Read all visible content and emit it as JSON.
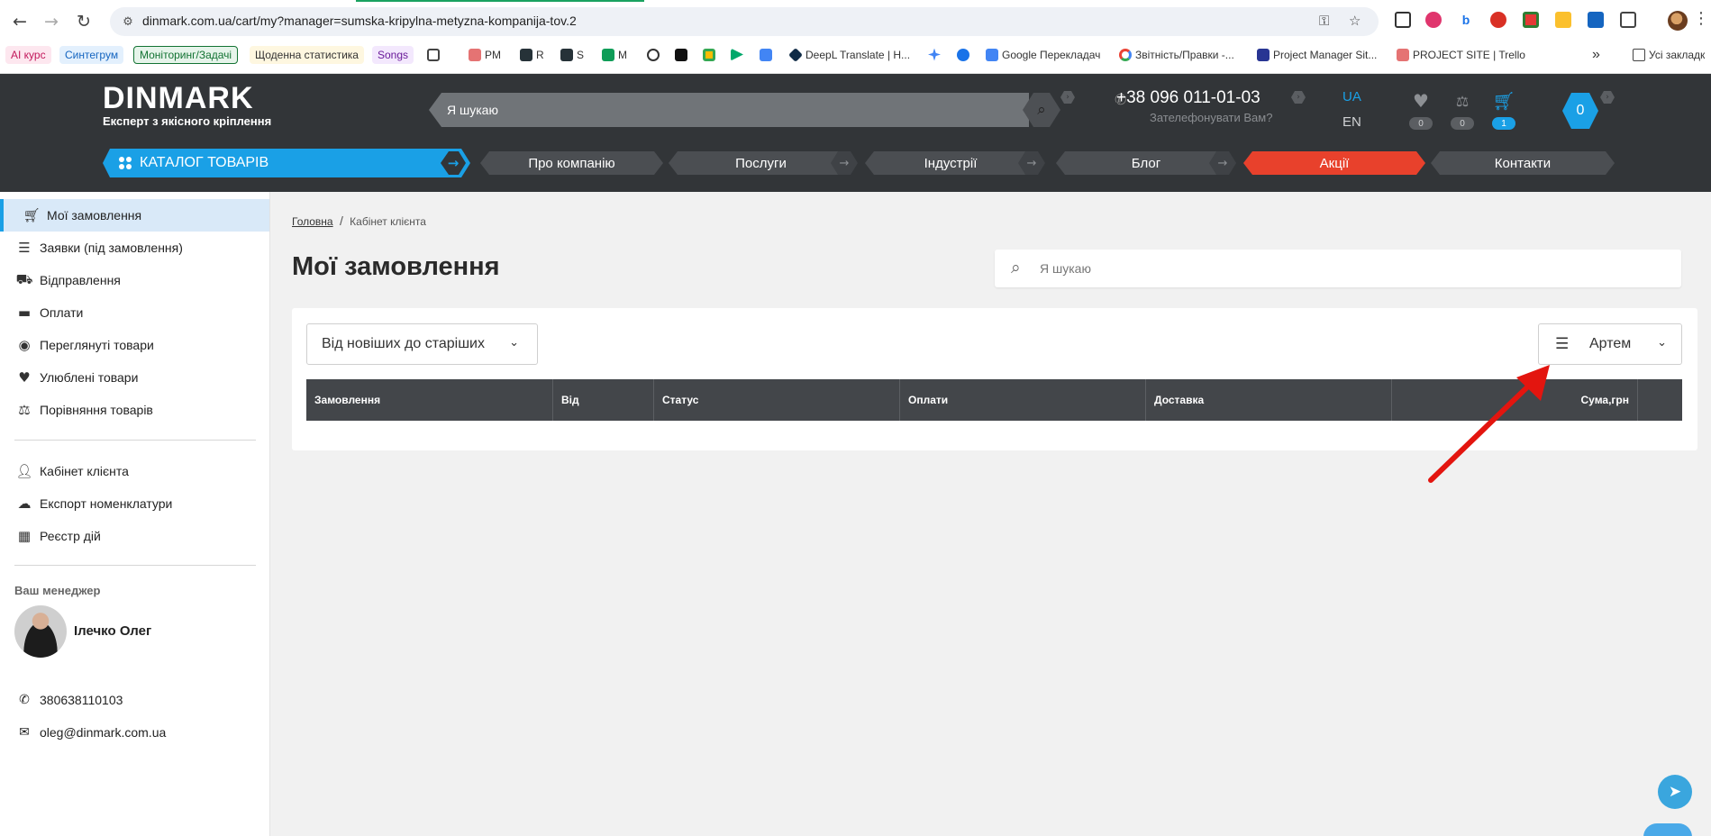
{
  "browser": {
    "url": "dinmark.com.ua/cart/my?manager=sumska-kripylna-metyzna-kompanija-tov.2",
    "bookmarks": [
      {
        "label": "AI курс",
        "kind": "chip-pink"
      },
      {
        "label": "Синтегрум",
        "kind": "chip-blue"
      },
      {
        "label": "Моніторинг/Задачі",
        "kind": "chip-green"
      },
      {
        "label": "Щоденна статистика",
        "kind": "chip-yellow"
      },
      {
        "label": "Songs",
        "kind": "chip-purple"
      },
      {
        "label": "",
        "kind": "grid"
      },
      {
        "label": "PM",
        "kind": "fav"
      },
      {
        "label": "R",
        "kind": "fav"
      },
      {
        "label": "S",
        "kind": "fav"
      },
      {
        "label": "M",
        "kind": "fav"
      },
      {
        "label": "",
        "kind": "fav"
      },
      {
        "label": "",
        "kind": "fav"
      },
      {
        "label": "",
        "kind": "fav"
      },
      {
        "label": "",
        "kind": "fav"
      },
      {
        "label": "",
        "kind": "fav"
      },
      {
        "label": "DeepL Translate | H...",
        "kind": "fav"
      },
      {
        "label": "",
        "kind": "fav"
      },
      {
        "label": "",
        "kind": "fav"
      },
      {
        "label": "Google Перекладач",
        "kind": "fav"
      },
      {
        "label": "Звітність/Правки -...",
        "kind": "fav"
      },
      {
        "label": "Project Manager Sit...",
        "kind": "fav"
      },
      {
        "label": "PROJECT SITE | Trello",
        "kind": "fav"
      }
    ],
    "more_bookmarks": "»",
    "all_bookmarks": "Усі закладк"
  },
  "site": {
    "logo_word": "DINMARK",
    "logo_tagline": "Експерт з якісного кріплення",
    "search_placeholder": "Я шукаю",
    "phone": "+38 096 011-01-03",
    "callback": "Зателефонувати Вам?",
    "lang_active": "UA",
    "lang_other": "EN",
    "favorites_count": "0",
    "compare_count": "0",
    "cart_count": "1",
    "account_badge": "0",
    "catalog_label": "КАТАЛОГ ТОВАРІВ",
    "menu": [
      "Про компанію",
      "Послуги",
      "Індустрії",
      "Блог",
      "Акції",
      "Контакти"
    ],
    "accent": "#1aa0e6",
    "promo_color": "#e8412c"
  },
  "sidebar": {
    "items": [
      {
        "label": "Мої замовлення",
        "icon": "cart-icon",
        "active": true
      },
      {
        "label": "Заявки (під замовлення)",
        "icon": "list-icon",
        "active": false
      },
      {
        "label": "Відправлення",
        "icon": "truck-icon",
        "active": false
      },
      {
        "label": "Оплати",
        "icon": "card-icon",
        "active": false
      },
      {
        "label": "Переглянуті товари",
        "icon": "eye-icon",
        "active": false
      },
      {
        "label": "Улюблені товари",
        "icon": "heart-icon",
        "active": false
      },
      {
        "label": "Порівняння товарів",
        "icon": "scales-icon",
        "active": false
      }
    ],
    "items2": [
      {
        "label": "Кабінет клієнта",
        "icon": "user-icon"
      },
      {
        "label": "Експорт номенклатури",
        "icon": "cloud-download-icon"
      },
      {
        "label": "Реєстр дій",
        "icon": "sitemap-icon"
      }
    ],
    "manager_label": "Ваш менеджер",
    "manager_name": "Ілечко Олег",
    "manager_phone": "380638110103",
    "manager_email": "oleg@dinmark.com.ua"
  },
  "main": {
    "breadcrumb_home": "Головна",
    "breadcrumb_sep": "/",
    "breadcrumb_current": "Кабінет клієнта",
    "title": "Мої замовлення",
    "search_placeholder": "Я шукаю",
    "sort_value": "Від новіших до старіших",
    "manager_filter_value": "Артем",
    "columns": [
      "Замовлення",
      "Від",
      "Статус",
      "Оплати",
      "Доставка",
      "Сума,грн",
      ""
    ]
  }
}
